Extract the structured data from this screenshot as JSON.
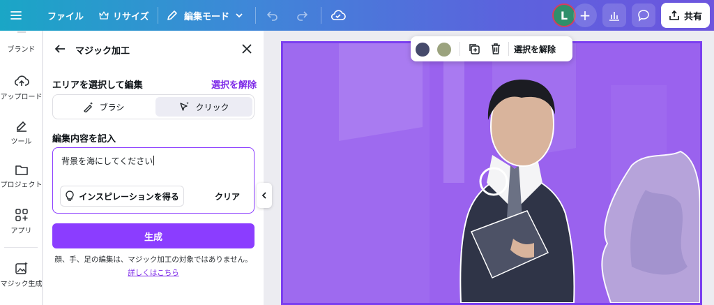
{
  "topbar": {
    "file_label": "ファイル",
    "resize_label": "リサイズ",
    "edit_mode_label": "編集モード",
    "avatar_initial": "L",
    "share_label": "共有"
  },
  "rail": {
    "items": [
      {
        "label": "ブランド",
        "icon": "brand-icon"
      },
      {
        "label": "アップロード",
        "icon": "cloud-upload-icon"
      },
      {
        "label": "ツール",
        "icon": "pen-tool-icon"
      },
      {
        "label": "プロジェクト",
        "icon": "folder-icon"
      },
      {
        "label": "アプリ",
        "icon": "apps-grid-icon"
      },
      {
        "label": "マジック生成",
        "icon": "magic-image-icon"
      }
    ]
  },
  "panel": {
    "title": "マジック加工",
    "select_area_label": "エリアを選択して編集",
    "deselect_label": "選択を解除",
    "brush_label": "ブラシ",
    "click_label": "クリック",
    "prompt_label": "編集内容を記入",
    "prompt_value": "背景を海にしてください",
    "inspiration_label": "インスピレーションを得る",
    "clear_label": "クリア",
    "generate_label": "生成",
    "note": "顔、手、足の編集は、マジック加工の対象ではありません。",
    "learn_more": "詳しくはこちら"
  },
  "float_toolbar": {
    "swatches": [
      "#454a6b",
      "#9ba37e"
    ],
    "deselect_label": "選択を解除"
  },
  "colors": {
    "accent": "#8b3dff",
    "selection": "#9a62ee"
  }
}
